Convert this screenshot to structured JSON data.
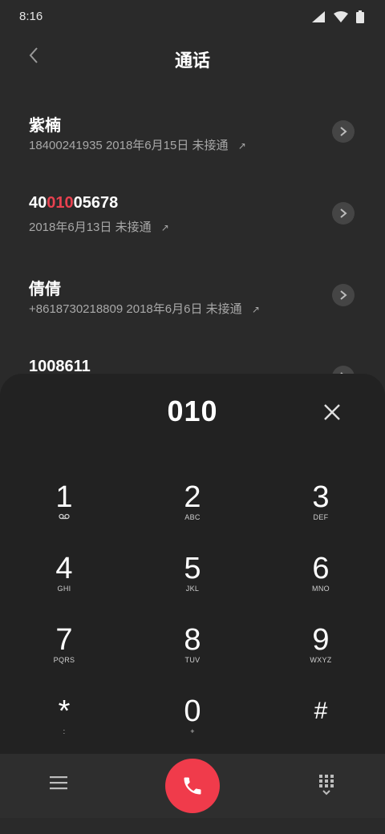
{
  "status": {
    "time": "8:16"
  },
  "header": {
    "title": "通话"
  },
  "calls": [
    {
      "name": "紫楠",
      "number": "18400241935",
      "date": "2018年6月15日",
      "status": "未接通"
    },
    {
      "name_pre": "40",
      "name_hl": "010",
      "name_post": "05678",
      "date": "2018年6月13日",
      "status": "未接通"
    },
    {
      "name": "倩倩",
      "number": "+8618730218809",
      "date": "2018年6月6日",
      "status": "未接通"
    },
    {
      "name": "1008611"
    }
  ],
  "dialpad": {
    "number": "010",
    "keys": [
      {
        "digit": "1",
        "letters": ""
      },
      {
        "digit": "2",
        "letters": "ABC"
      },
      {
        "digit": "3",
        "letters": "DEF"
      },
      {
        "digit": "4",
        "letters": "GHI"
      },
      {
        "digit": "5",
        "letters": "JKL"
      },
      {
        "digit": "6",
        "letters": "MNO"
      },
      {
        "digit": "7",
        "letters": "PQRS"
      },
      {
        "digit": "8",
        "letters": "TUV"
      },
      {
        "digit": "9",
        "letters": "WXYZ"
      },
      {
        "digit": "*",
        "letters": ":"
      },
      {
        "digit": "0",
        "letters": "+"
      },
      {
        "digit": "#",
        "letters": ""
      }
    ]
  },
  "icons": {
    "back": "chevron-left-icon",
    "detail": "chevron-right-icon",
    "clear": "close-icon",
    "voicemail": "voicemail-icon",
    "menu": "menu-icon",
    "call": "phone-icon",
    "keypad": "dialpad-icon"
  },
  "colors": {
    "accent": "#f03b4b",
    "highlight": "#e8414f",
    "background": "#2a2a2a",
    "dialpad_bg": "#222222"
  }
}
